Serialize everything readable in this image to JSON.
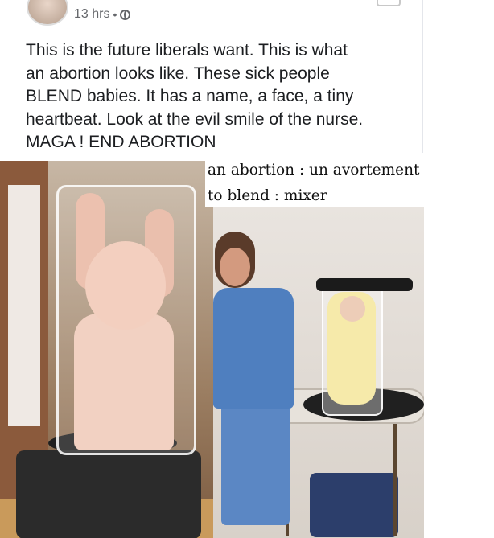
{
  "post": {
    "timestamp": "13 hrs",
    "separator": "•",
    "audience_icon": "globe-icon",
    "text_lines": [
      "This is the future liberals want. This is what",
      "an abortion looks like. These sick people",
      "BLEND babies. It has a name, a face, a tiny",
      "heartbeat. Look at the evil smile of the nurse.",
      "MAGA ! END ABORTION"
    ]
  },
  "caption": {
    "line1": "an abortion : un avortement",
    "line2": "to blend : mixer"
  }
}
